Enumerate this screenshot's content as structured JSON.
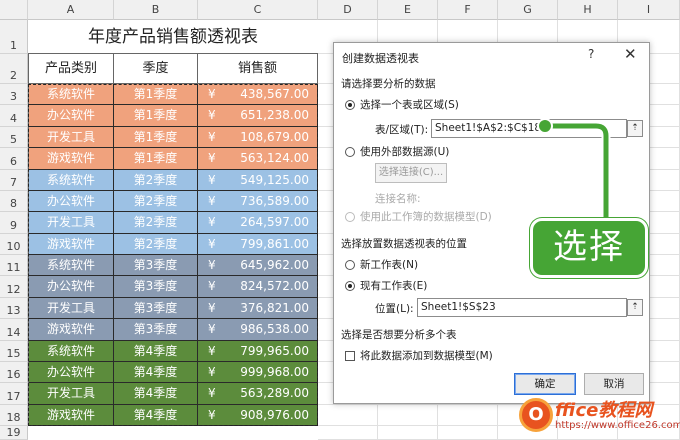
{
  "sheet": {
    "columns": [
      "A",
      "B",
      "C",
      "D",
      "E",
      "F",
      "G",
      "H",
      "I"
    ],
    "rows": [
      "1",
      "2",
      "3",
      "4",
      "5",
      "6",
      "7",
      "8",
      "9",
      "10",
      "11",
      "12",
      "13",
      "14",
      "15",
      "16",
      "17",
      "18",
      "19"
    ],
    "title": "年度产品销售额透视表",
    "headers": [
      "产品类别",
      "季度",
      "销售额"
    ],
    "currency": "¥",
    "data_rows": [
      {
        "category": "系统软件",
        "quarter": "第1季度",
        "amount": "438,567.00",
        "q": 1
      },
      {
        "category": "办公软件",
        "quarter": "第1季度",
        "amount": "651,238.00",
        "q": 1
      },
      {
        "category": "开发工具",
        "quarter": "第1季度",
        "amount": "108,679.00",
        "q": 1
      },
      {
        "category": "游戏软件",
        "quarter": "第1季度",
        "amount": "563,124.00",
        "q": 1
      },
      {
        "category": "系统软件",
        "quarter": "第2季度",
        "amount": "549,125.00",
        "q": 2
      },
      {
        "category": "办公软件",
        "quarter": "第2季度",
        "amount": "736,589.00",
        "q": 2
      },
      {
        "category": "开发工具",
        "quarter": "第2季度",
        "amount": "264,597.00",
        "q": 2
      },
      {
        "category": "游戏软件",
        "quarter": "第2季度",
        "amount": "799,861.00",
        "q": 2
      },
      {
        "category": "系统软件",
        "quarter": "第3季度",
        "amount": "645,962.00",
        "q": 3
      },
      {
        "category": "办公软件",
        "quarter": "第3季度",
        "amount": "824,572.00",
        "q": 3
      },
      {
        "category": "开发工具",
        "quarter": "第3季度",
        "amount": "376,821.00",
        "q": 3
      },
      {
        "category": "游戏软件",
        "quarter": "第3季度",
        "amount": "986,538.00",
        "q": 3
      },
      {
        "category": "系统软件",
        "quarter": "第4季度",
        "amount": "799,965.00",
        "q": 4
      },
      {
        "category": "办公软件",
        "quarter": "第4季度",
        "amount": "999,968.00",
        "q": 4
      },
      {
        "category": "开发工具",
        "quarter": "第4季度",
        "amount": "563,289.00",
        "q": 4
      },
      {
        "category": "游戏软件",
        "quarter": "第4季度",
        "amount": "908,976.00",
        "q": 4
      }
    ],
    "quarter_colors": {
      "1": "#f0a27d",
      "2": "#9cc1e4",
      "3": "#8a9bb2",
      "4": "#5c8c3c"
    }
  },
  "dialog": {
    "title": "创建数据透视表",
    "help": "?",
    "close": "✕",
    "section_source": "请选择要分析的数据",
    "opt_table": "选择一个表或区域(S)",
    "range_label": "表/区域(T):",
    "range_value": "Sheet1!$A$2:$C$18",
    "opt_external": "使用外部数据源(U)",
    "choose_connection": "选择连接(C)...",
    "connection_name": "连接名称:",
    "opt_model": "使用此工作簿的数据模型(D)",
    "section_location": "选择放置数据透视表的位置",
    "opt_new_sheet": "新工作表(N)",
    "opt_existing_sheet": "现有工作表(E)",
    "location_label": "位置(L):",
    "location_value": "Sheet1!$S$23",
    "section_multi": "选择是否想要分析多个表",
    "check_model": "将此数据添加到数据模型(M)",
    "ok": "确定",
    "cancel": "取消",
    "picker_icon": "range-picker-icon"
  },
  "callout": {
    "text": "选择",
    "color": "#46a535"
  },
  "watermark": {
    "logo_letter": "O",
    "name": "ffice教程网",
    "url": "https://www.office26.com"
  }
}
